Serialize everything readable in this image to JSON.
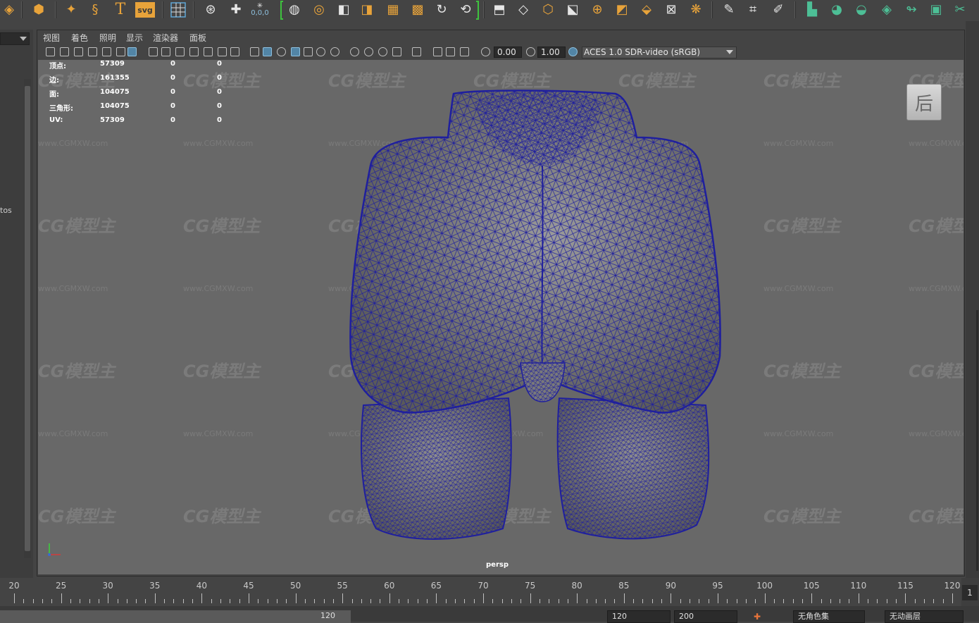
{
  "shelf": {
    "icons": [
      "polygon-cube-icon",
      "soccer-ball-icon",
      "sparkle-star-icon",
      "helix-icon",
      "text-icon",
      "svg-icon",
      "grid-plane-icon",
      "measure-icon",
      "snap-cross-icon",
      "particle-icon",
      "sculpt-icon",
      "layers-icon",
      "boolean-union-icon",
      "mirror-icon",
      "grid-combine-icon",
      "grid-separate-icon",
      "loop-icon",
      "fill-hole-icon",
      "extrude-icon",
      "bridge-icon",
      "box-add-icon",
      "merge-icon",
      "sphere-cut-icon",
      "cube-wedge-icon",
      "plane-slice-icon",
      "frame-target-icon",
      "gear-icon",
      "pen-draw-icon",
      "crop-select-icon",
      "pen-edit-icon",
      "green-uv-icon-1",
      "green-uv-icon-2",
      "green-uv-icon-3",
      "green-uv-icon-4",
      "green-uv-icon-5",
      "green-checker-icon",
      "green-scissors-icon"
    ],
    "svg_label": "svg",
    "coord_label": "0,0,0"
  },
  "left_panel": {
    "partial_text": "tos"
  },
  "viewport_menu": [
    "视图",
    "着色",
    "照明",
    "显示",
    "渲染器",
    "面板"
  ],
  "toolbar": {
    "exposure_value": "0.00",
    "gamma_value": "1.00",
    "color_space": "ACES 1.0 SDR-video (sRGB)"
  },
  "hud": {
    "rows": [
      {
        "label": "顶点:",
        "total": "57309",
        "selected": "0",
        "extra": "0"
      },
      {
        "label": "边:",
        "total": "161355",
        "selected": "0",
        "extra": "0"
      },
      {
        "label": "面:",
        "total": "104075",
        "selected": "0",
        "extra": "0"
      },
      {
        "label": "三角形:",
        "total": "104075",
        "selected": "0",
        "extra": "0"
      },
      {
        "label": "UV:",
        "total": "57309",
        "selected": "0",
        "extra": "0"
      }
    ]
  },
  "view_cube_label": "后",
  "camera_label": "persp",
  "axis": {
    "x": "x",
    "y": "y"
  },
  "watermark": {
    "logo_text": "CG模型主",
    "url_text": "www.CGMXW.com"
  },
  "timeline": {
    "labels": [
      "20",
      "25",
      "30",
      "35",
      "40",
      "45",
      "50",
      "55",
      "60",
      "65",
      "70",
      "75",
      "80",
      "85",
      "90",
      "95",
      "100",
      "105",
      "110",
      "115",
      "120"
    ],
    "current_frame": "1"
  },
  "range": {
    "start_value": "120",
    "end_value": "120",
    "max_value": "200",
    "character_set": "无角色集",
    "anim_layer": "无动画层"
  },
  "colors": {
    "viewport_bg": "#686868",
    "wireframe": "#1f1f9e",
    "mesh_fill": "#8a8a8a",
    "accent_blue": "#5285a6",
    "shelf_orange": "#e8a33a",
    "shelf_green": "#4dbf96"
  }
}
